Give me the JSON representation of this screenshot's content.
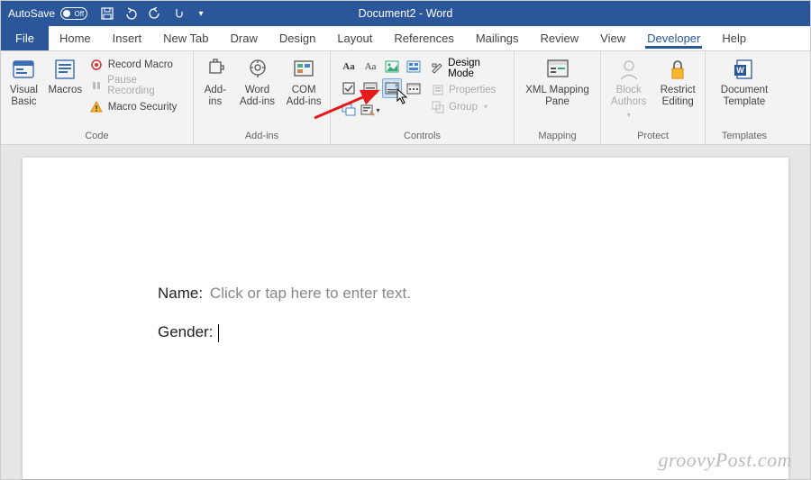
{
  "title": "Document2 - Word",
  "autosave": {
    "label": "AutoSave",
    "state": "Off"
  },
  "menu": {
    "file": "File",
    "tabs": [
      "Home",
      "Insert",
      "New Tab",
      "Draw",
      "Design",
      "Layout",
      "References",
      "Mailings",
      "Review",
      "View",
      "Developer",
      "Help"
    ],
    "active": "Developer"
  },
  "ribbon": {
    "code": {
      "label": "Code",
      "visual_basic": "Visual\nBasic",
      "macros": "Macros",
      "record": "Record Macro",
      "pause": "Pause Recording",
      "security": "Macro Security"
    },
    "addins": {
      "label": "Add-ins",
      "addins": "Add-\nins",
      "word": "Word\nAdd-ins",
      "com": "COM\nAdd-ins"
    },
    "controls": {
      "label": "Controls",
      "design": "Design Mode",
      "properties": "Properties",
      "group": "Group"
    },
    "mapping": {
      "label": "Mapping",
      "xml": "XML Mapping\nPane"
    },
    "protect": {
      "label": "Protect",
      "block": "Block\nAuthors",
      "restrict": "Restrict\nEditing"
    },
    "templates": {
      "label": "Templates",
      "doc": "Document\nTemplate"
    }
  },
  "document": {
    "name_label": "Name:",
    "name_placeholder": "Click or tap here to enter text.",
    "gender_label": "Gender:"
  },
  "watermark": "groovyPost.com"
}
